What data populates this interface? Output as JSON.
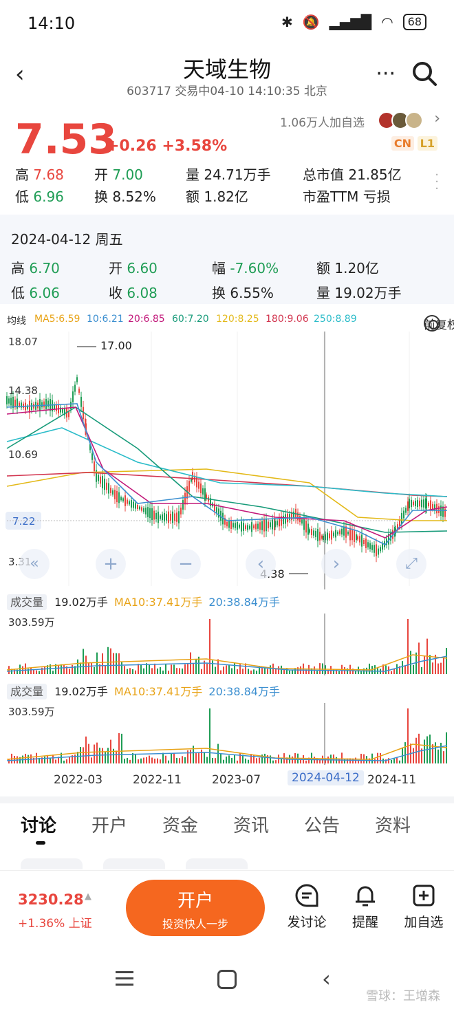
{
  "status_bar": {
    "time": "14:10",
    "battery": "68"
  },
  "header": {
    "title": "天域生物",
    "subtitle": "603717 交易中04-10 14:10:35 北京"
  },
  "quote": {
    "price": "7.53",
    "change": "+0.26 +3.58%",
    "followers": "1.06万人加自选",
    "tag_cn": "CN",
    "tag_l1": "L1",
    "high_label": "高",
    "high": "7.68",
    "low_label": "低",
    "low": "6.96",
    "open_label": "开",
    "open": "7.00",
    "turnover_label": "换",
    "turnover": "8.52%",
    "volume": "量 24.71万手",
    "amount": "额 1.82亿",
    "market_cap": "总市值 21.85亿",
    "pe": "市盈TTM 亏损"
  },
  "detail": {
    "date": "2024-04-12 周五",
    "high_label": "高",
    "high": "6.70",
    "open_label": "开",
    "open": "6.60",
    "range_label": "幅",
    "range": "-7.60%",
    "amount": "额 1.20亿",
    "low_label": "低",
    "low": "6.06",
    "close_label": "收",
    "close": "6.08",
    "turnover_label": "换",
    "turnover": "6.55%",
    "volume": "量 19.02万手"
  },
  "ma": {
    "label": "均线",
    "items": [
      {
        "text": "MA5:6.59",
        "color": "#e8a317"
      },
      {
        "text": "10:6.21",
        "color": "#3c8fd0"
      },
      {
        "text": "20:6.85",
        "color": "#c2187a"
      },
      {
        "text": "60:7.20",
        "color": "#189b7a"
      },
      {
        "text": "120:8.25",
        "color": "#e3b919"
      },
      {
        "text": "180:9.06",
        "color": "#d2354f"
      },
      {
        "text": "250:8.89",
        "color": "#2bbcc9"
      }
    ],
    "adjust": "前复权"
  },
  "chart_data": {
    "type": "candlestick",
    "y_ticks": [
      "18.07",
      "14.38",
      "10.69",
      "7.22",
      "3.31"
    ],
    "current_price_label": "7.22",
    "max_label": "17.00",
    "min_label": "4.38",
    "x_ticks": [
      "2022-03",
      "2022-11",
      "2023-07",
      "2024-04-12",
      "2024-11"
    ],
    "selected_date": "2024-04-12"
  },
  "volume_panels": [
    {
      "label": "成交量",
      "value": "19.02万手",
      "ma10": "MA10:37.41万手",
      "ma20": "20:38.84万手",
      "ymax": "303.59万"
    },
    {
      "label": "成交量",
      "value": "19.02万手",
      "ma10": "MA10:37.41万手",
      "ma20": "20:38.84万手",
      "ymax": "303.59万"
    }
  ],
  "tabs": [
    "讨论",
    "开户",
    "资金",
    "资讯",
    "公告",
    "资料"
  ],
  "bottom": {
    "index_value": "3230.28",
    "index_change": "+1.36% 上证",
    "open_btn_title": "开户",
    "open_btn_sub": "投资快人一步",
    "discuss": "发讨论",
    "remind": "提醒",
    "add_fav": "加自选"
  },
  "watermark": "雪球：王增森"
}
